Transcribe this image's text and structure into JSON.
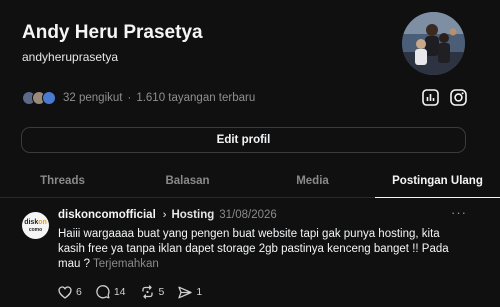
{
  "profile": {
    "name": "Andy Heru Prasetya",
    "handle": "andyheruprasetya",
    "followers_text": "32 pengikut",
    "separator": "·",
    "views_text": "1.610 tayangan terbaru"
  },
  "buttons": {
    "edit_profile": "Edit profil"
  },
  "tabs": [
    {
      "label": "Threads"
    },
    {
      "label": "Balasan"
    },
    {
      "label": "Media"
    },
    {
      "label": "Postingan Ulang"
    }
  ],
  "post": {
    "avatar_text_a": "disk",
    "avatar_text_b": "on",
    "avatar_text_c": "como",
    "author": "diskoncomofficial",
    "chevron": "›",
    "topic": "Hosting",
    "date": "31/08/2026",
    "more": "···",
    "body": "Haiii wargaaaa buat yang pengen buat website tapi gak punya hosting, kita kasih free ya tanpa iklan dapet storage 2gb pastinya kenceng banget !! Pada mau ? ",
    "translate": "Terjemahkan",
    "likes": "6",
    "replies": "14",
    "reposts": "5",
    "shares": "1"
  },
  "colors": {
    "background": "#101010",
    "text": "#f3f5f7",
    "muted": "#8a8a8a",
    "border": "#3b3b3b"
  }
}
